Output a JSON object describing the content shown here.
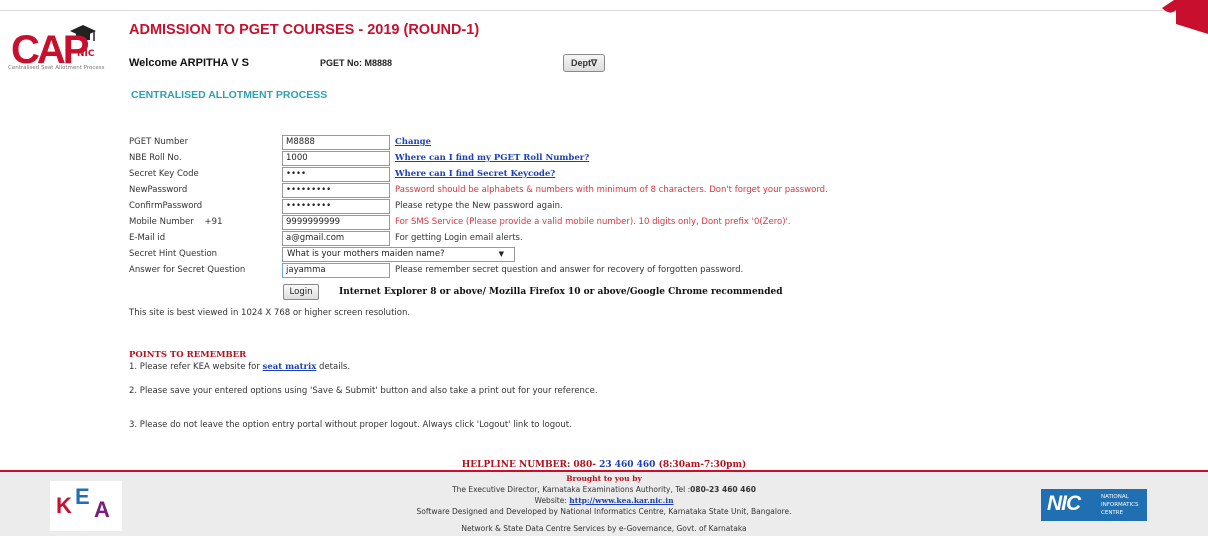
{
  "header": {
    "logo_text": "CAP",
    "logo_nic": "NIC",
    "logo_subtitle": "Centralised Seat Allotment Process",
    "title": "ADMISSION TO PGET COURSES - 2019 (ROUND-1)",
    "welcome": "Welcome ARPITHA V S",
    "pget_no": "PGET No: M8888",
    "dept_button": "Dept∇"
  },
  "section_title": "CENTRALISED ALLOTMENT PROCESS",
  "form": {
    "rows": [
      {
        "label": "PGET Number",
        "value": "M8888",
        "note": "Change",
        "note_type": "link"
      },
      {
        "label": "NBE Roll No.",
        "value": "1000",
        "note": "Where can I find my PGET Roll Number?",
        "note_type": "link"
      },
      {
        "label": "Secret Key Code",
        "value": "••••",
        "note": "Where can I find Secret Keycode?",
        "note_type": "link"
      },
      {
        "label": "NewPassword",
        "value": "•••••••••",
        "note": "Password should be alphabets & numbers with minimum of 8 characters. Don't forget your password.",
        "note_type": "red"
      },
      {
        "label": "ConfirmPassword",
        "value": "•••••••••",
        "note": "Please retype the New password again.",
        "note_type": "dark"
      },
      {
        "label": "Mobile Number    +91",
        "value": "9999999999",
        "note": "For SMS Service (Please provide a valid mobile number). 10 digits only, Dont prefix '0(Zero)'.",
        "note_type": "red"
      },
      {
        "label": "E-Mail id",
        "value": "a@gmail.com",
        "note": "For getting Login email alerts.",
        "note_type": "dark"
      }
    ],
    "hint_question": {
      "label": "Secret Hint Question",
      "selected": "What is your mothers maiden name?"
    },
    "answer": {
      "label": "Answer for Secret Question",
      "value": "jayamma",
      "note": "Please remember secret question and answer for recovery of forgotten password."
    },
    "login_button": "Login",
    "browser_note": "Internet Explorer 8 or above/ Mozilla Firefox 10 or above/Google Chrome recommended",
    "best_view": "This site is best viewed in 1024 X 768 or higher screen resolution."
  },
  "points": {
    "title": "POINTS TO REMEMBER",
    "p1_before": "1. Please refer KEA website for ",
    "p1_link": "seat matrix",
    "p1_after": " details.",
    "p2": "2. Please save your entered options using 'Save & Submit' button and also take a print out for your reference.",
    "p3": "3. Please do not leave the option entry portal without proper logout. Always click 'Logout' link to logout."
  },
  "footer": {
    "helpline_label": "HELPLINE NUMBER: 080- ",
    "helpline_number": "23 460 460",
    "helpline_hours": " (8:30am-7:30pm)",
    "brought": "Brought to you by",
    "director": "The Executive Director, Karnataka Examinations Authority, Tel :",
    "tel": "080-23 460 460",
    "website_label": "Website: ",
    "website": "http://www.kea.kar.nic.in",
    "designed": "Software Designed and Developed by National Informatics Centre, Karnataka State Unit, Bangalore.",
    "network": "Network & State Data Centre Services by e-Governance, Govt. of Karnataka",
    "kea_logo_text": "KEA",
    "nic_logo_text": "NIC",
    "nic_logo_sub1": "NATIONAL",
    "nic_logo_sub2": "INFORMATICS",
    "nic_logo_sub3": "CENTRE"
  },
  "colors": {
    "accent_red": "#c8102e",
    "section_teal": "#2f9fb4",
    "link_blue": "#1a3fb8"
  }
}
